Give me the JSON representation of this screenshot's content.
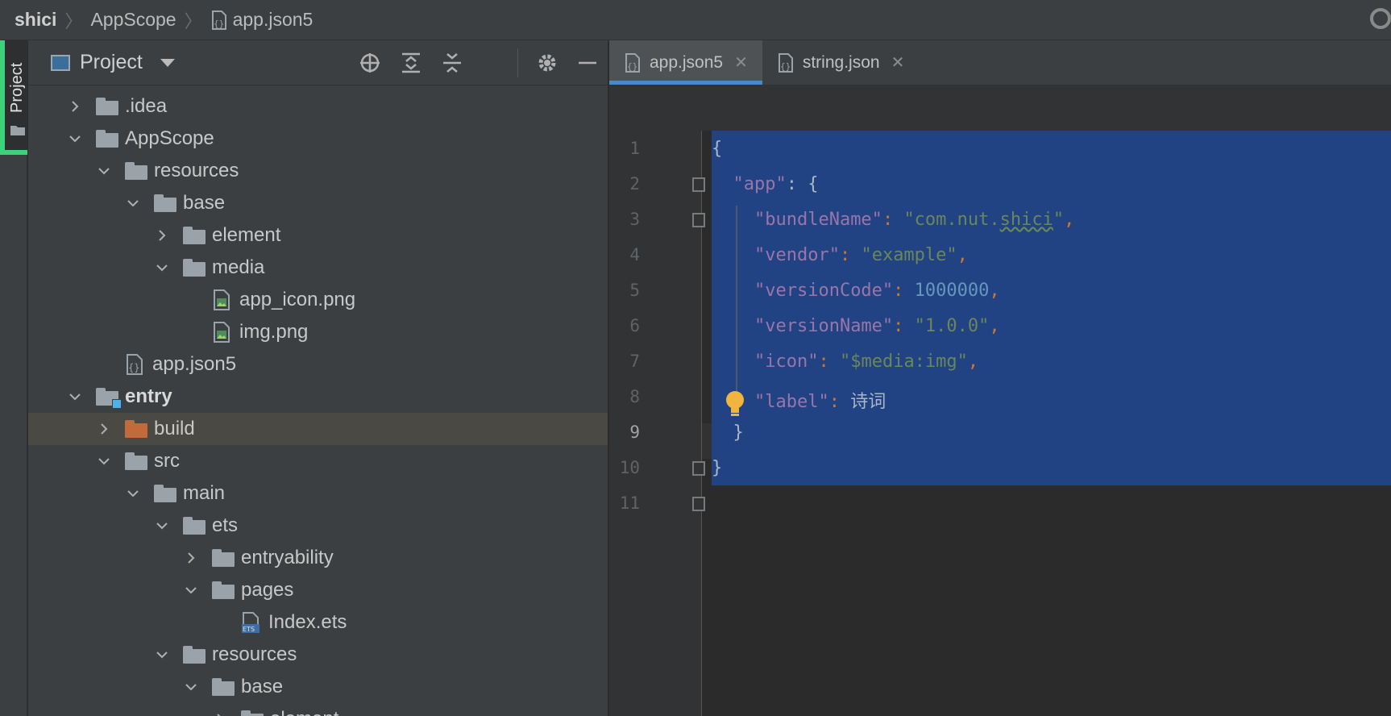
{
  "breadcrumb": {
    "items": [
      "shici",
      "AppScope",
      "app.json5"
    ]
  },
  "sidebar_stripe": {
    "label": "Project"
  },
  "project_panel": {
    "title": "Project",
    "tree": [
      {
        "label": ".idea",
        "level": 1,
        "expanded": false,
        "type": "folder"
      },
      {
        "label": "AppScope",
        "level": 1,
        "expanded": true,
        "type": "folder"
      },
      {
        "label": "resources",
        "level": 2,
        "expanded": true,
        "type": "folder"
      },
      {
        "label": "base",
        "level": 3,
        "expanded": true,
        "type": "folder"
      },
      {
        "label": "element",
        "level": 4,
        "expanded": false,
        "type": "folder"
      },
      {
        "label": "media",
        "level": 4,
        "expanded": true,
        "type": "folder"
      },
      {
        "label": "app_icon.png",
        "level": 5,
        "type": "image"
      },
      {
        "label": "img.png",
        "level": 5,
        "type": "image"
      },
      {
        "label": "app.json5",
        "level": 2,
        "type": "json"
      },
      {
        "label": "entry",
        "level": 1,
        "expanded": true,
        "type": "module"
      },
      {
        "label": "build",
        "level": 2,
        "expanded": false,
        "type": "folder-orange",
        "selected": true
      },
      {
        "label": "src",
        "level": 2,
        "expanded": true,
        "type": "folder"
      },
      {
        "label": "main",
        "level": 3,
        "expanded": true,
        "type": "folder"
      },
      {
        "label": "ets",
        "level": 4,
        "expanded": true,
        "type": "folder"
      },
      {
        "label": "entryability",
        "level": 5,
        "expanded": false,
        "type": "folder"
      },
      {
        "label": "pages",
        "level": 5,
        "expanded": true,
        "type": "folder"
      },
      {
        "label": "Index.ets",
        "level": 6,
        "type": "ets"
      },
      {
        "label": "resources",
        "level": 4,
        "expanded": true,
        "type": "folder"
      },
      {
        "label": "base",
        "level": 5,
        "expanded": true,
        "type": "folder"
      },
      {
        "label": "element",
        "level": 6,
        "expanded": false,
        "type": "folder"
      }
    ]
  },
  "editor": {
    "tabs": [
      {
        "label": "app.json5",
        "active": true
      },
      {
        "label": "string.json",
        "active": false
      }
    ],
    "current_line": 9,
    "line_numbers": [
      "1",
      "2",
      "3",
      "4",
      "5",
      "6",
      "7",
      "8",
      "9",
      "10",
      "11"
    ],
    "code": {
      "l1": "{",
      "l2_key": "\"app\"",
      "l2_rest": ": {",
      "l3_key": "\"bundleName\"",
      "l3_val_a": "\"com.nut.",
      "l3_val_b": "shici",
      "l3_val_c": "\"",
      "l4_key": "\"vendor\"",
      "l4_val": "\"example\"",
      "l5_key": "\"versionCode\"",
      "l5_val": "1000000",
      "l6_key": "\"versionName\"",
      "l6_val": "\"1.0.0\"",
      "l7_key": "\"icon\"",
      "l7_val": "\"$media:img\"",
      "l8_key": "\"label\"",
      "l8_val": "诗词",
      "l9": "}",
      "l10": "}",
      "colon": ": ",
      "comma": ","
    }
  }
}
